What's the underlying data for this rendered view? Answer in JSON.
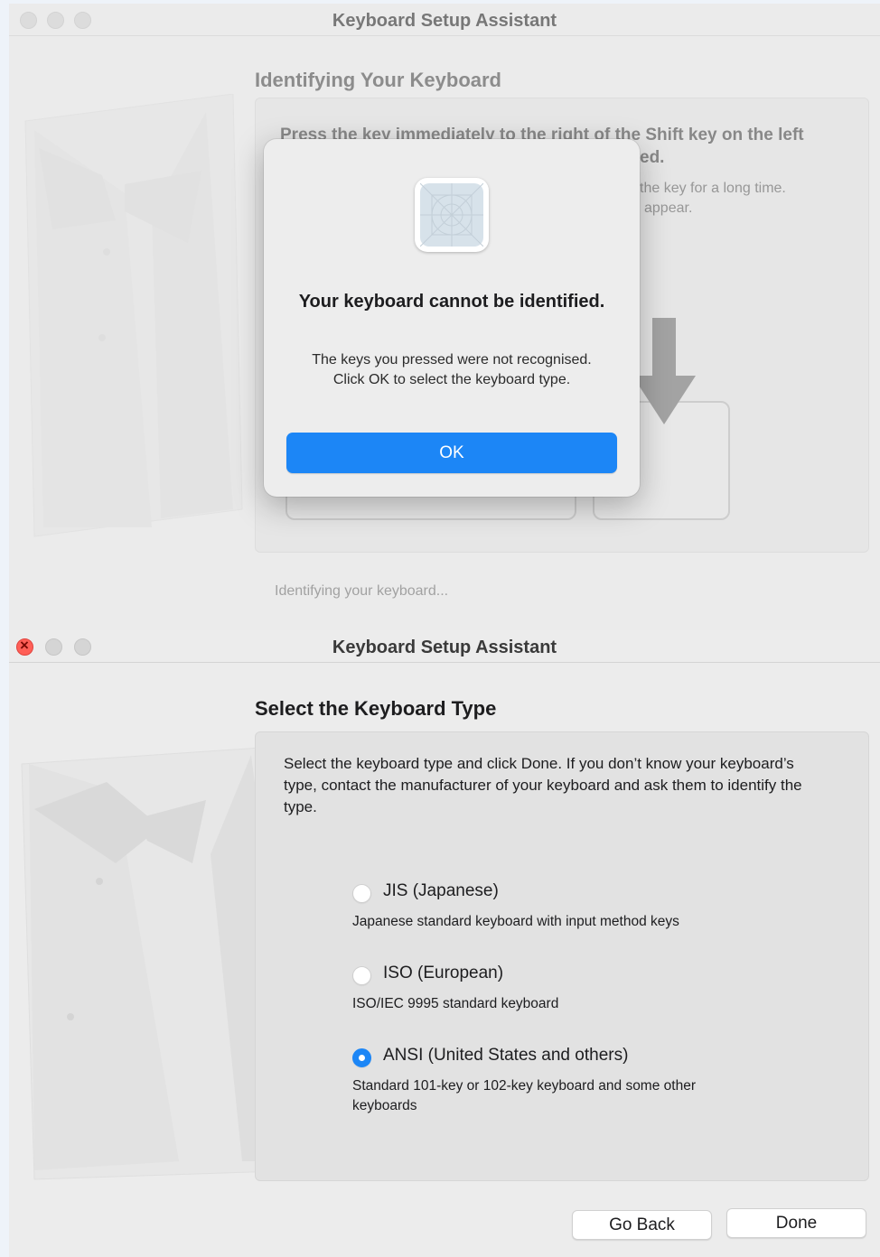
{
  "window1": {
    "title": "Keyboard Setup Assistant",
    "heading": "Identifying Your Keyboard",
    "instruction_line1": "Press the key immediately to the right of the Shift key on the left",
    "instruction_line2_visible": "ed.",
    "note_line1_visible": "the key for a long time.",
    "note_line2_visible": "appear.",
    "status": "Identifying your keyboard...",
    "dialog": {
      "icon": "app-placeholder-icon",
      "title": "Your keyboard cannot be identified.",
      "body": "The keys you pressed were not recognised. Click OK to select the keyboard type.",
      "ok_label": "OK"
    }
  },
  "window2": {
    "title": "Keyboard Setup Assistant",
    "heading": "Select the Keyboard Type",
    "intro": "Select the keyboard type and click Done. If you don’t know your keyboard’s type, contact the manufacturer of your keyboard and ask them to identify the type.",
    "options": [
      {
        "label": "JIS (Japanese)",
        "description": "Japanese standard keyboard with input method keys",
        "selected": false
      },
      {
        "label": "ISO (European)",
        "description": "ISO/IEC 9995 standard keyboard",
        "selected": false
      },
      {
        "label": "ANSI (United States and others)",
        "description": "Standard 101-key or 102-key keyboard and some other keyboards",
        "selected": true
      }
    ],
    "buttons": {
      "back": "Go Back",
      "done": "Done"
    }
  },
  "colors": {
    "accent": "#1c86f6",
    "close": "#ff5f57"
  }
}
